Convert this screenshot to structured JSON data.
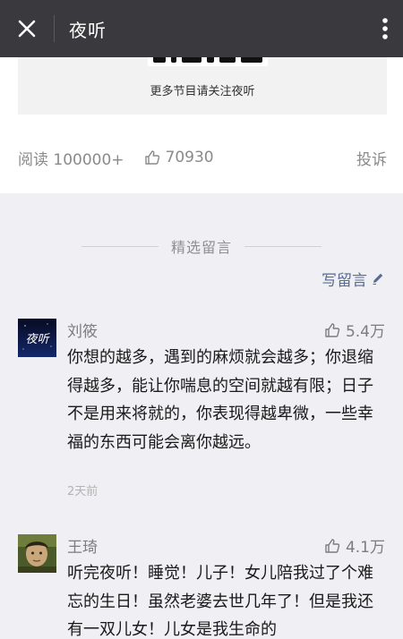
{
  "topbar": {
    "title": "夜听",
    "close_icon": "close-icon",
    "more_icon": "more-vertical-icon"
  },
  "article": {
    "promo_text": "更多节目请关注夜听",
    "read_label": "阅读 100000+",
    "like_count": "70930",
    "report_label": "投诉"
  },
  "comments_section": {
    "title": "精选留言",
    "write_label": "写留言"
  },
  "comments": [
    {
      "name": "刘筱",
      "avatar_text": "夜听",
      "likes": "5.4万",
      "text": "你想的越多，遇到的麻烦就会越多；你退缩得越多，能让你喘息的空间就越有限；日子不是用来将就的，你表现得越卑微，一些幸福的东西可能会离你越远。",
      "time": "2天前"
    },
    {
      "name": "王琦",
      "likes": "4.1万",
      "text": "听完夜听！睡觉！儿子！女儿陪我过了个难忘的生日！虽然老婆去世几年了！但是我还有一双儿女！儿女是我生命的"
    }
  ],
  "colors": {
    "topbar": "#3a3a3e",
    "link": "#576b95",
    "background": "#efeff4"
  }
}
